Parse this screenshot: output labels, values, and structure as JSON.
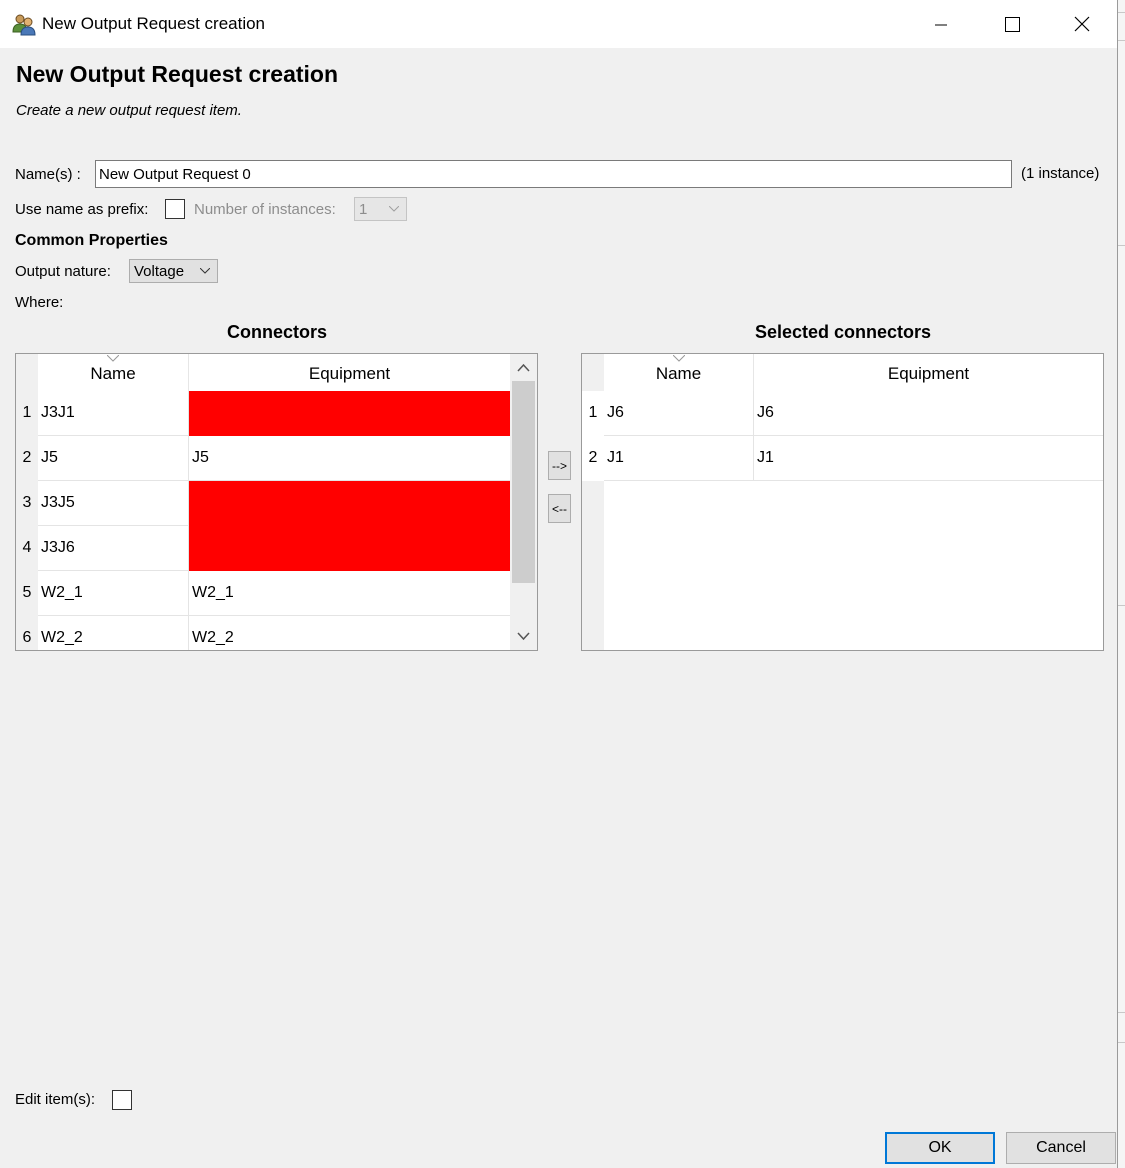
{
  "window": {
    "title": "New Output Request creation",
    "app_icon": "users-icon"
  },
  "header": {
    "title": "New Output Request creation",
    "subtitle": "Create a new output request item."
  },
  "form": {
    "names_label": "Name(s) :",
    "names_value": "New Output Request 0",
    "instance_count": "(1 instance)",
    "prefix_label": "Use name as prefix:",
    "prefix_checked": false,
    "instances_label": "Number of instances:",
    "instances_value": "1",
    "common_properties": "Common Properties",
    "output_nature_label": "Output nature:",
    "output_nature_value": "Voltage",
    "where_label": "Where:"
  },
  "connectors": {
    "title": "Connectors",
    "columns": [
      "Name",
      "Equipment"
    ],
    "rows": [
      {
        "n": "1",
        "name": "J3J1",
        "equipment": "",
        "error": true
      },
      {
        "n": "2",
        "name": "J5",
        "equipment": "J5",
        "error": false
      },
      {
        "n": "3",
        "name": "J3J5",
        "equipment": "",
        "error": true
      },
      {
        "n": "4",
        "name": "J3J6",
        "equipment": "",
        "error": true
      },
      {
        "n": "5",
        "name": "W2_1",
        "equipment": "W2_1",
        "error": false
      },
      {
        "n": "6",
        "name": "W2_2",
        "equipment": "W2_2",
        "error": false
      }
    ]
  },
  "selected": {
    "title": "Selected connectors",
    "columns": [
      "Name",
      "Equipment"
    ],
    "rows": [
      {
        "n": "1",
        "name": "J6",
        "equipment": "J6"
      },
      {
        "n": "2",
        "name": "J1",
        "equipment": "J1"
      }
    ]
  },
  "transfer": {
    "add_label": "-->",
    "remove_label": "<--"
  },
  "footer": {
    "edit_label": "Edit item(s):",
    "edit_checked": false,
    "ok_label": "OK",
    "cancel_label": "Cancel"
  },
  "colors": {
    "error_cell": "#ff0000",
    "default_button_border": "#0078d7"
  }
}
